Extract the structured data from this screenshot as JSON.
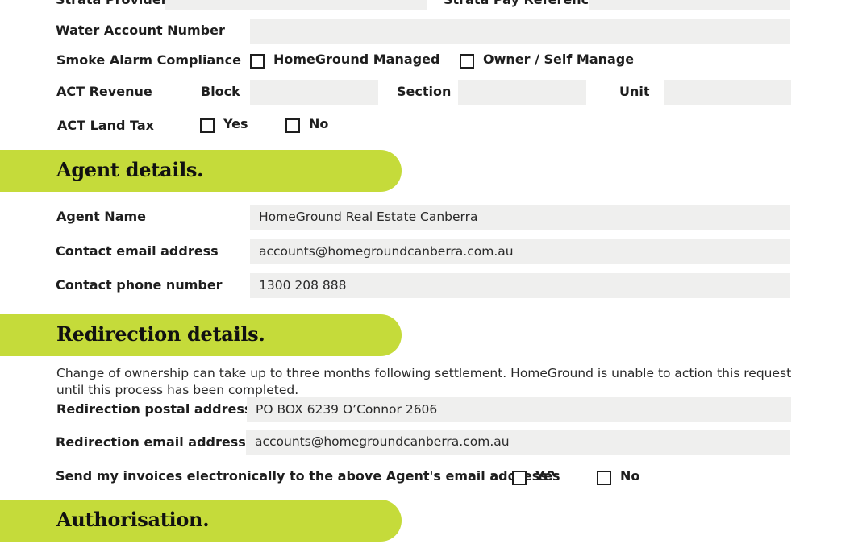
{
  "property_section": {
    "strata_provider_label": "Strata Provider",
    "strata_pay_reference_label": "Strata Pay Reference",
    "water_account_label": "Water Account Number",
    "smoke_alarm_label": "Smoke Alarm Compliance",
    "smoke_alarm_options": [
      "HomeGround Managed",
      "Owner / Self Manage"
    ],
    "act_revenue_label": "ACT Revenue",
    "block_label": "Block",
    "section_label": "Section",
    "unit_label": "Unit",
    "act_land_tax_label": "ACT Land Tax",
    "land_tax_options": [
      "Yes",
      "No"
    ]
  },
  "agent_details": {
    "title": "Agent details.",
    "agent_name_label": "Agent Name",
    "agent_name_value": "HomeGround Real Estate Canberra",
    "email_label": "Contact email address",
    "email_value": "accounts@homegroundcanberra.com.au",
    "phone_label": "Contact phone number",
    "phone_value": "1300 208 888"
  },
  "redirection_details": {
    "title": "Redirection details.",
    "note_line1": "Change of ownership can take up to three months following settlement. HomeGround is unable to action this request",
    "note_line2": "until this process has been completed.",
    "postal_label": "Redirection postal address",
    "postal_value": "PO BOX 6239 O’Connor 2606",
    "email_label": "Redirection email address",
    "email_value": "accounts@homegroundcanberra.com.au",
    "invoice_question": "Send my invoices electronically to the above Agent's email address?",
    "invoice_options": [
      "Yes",
      "No"
    ]
  },
  "authorisation": {
    "title": "Authorisation."
  },
  "colors": {
    "banner": "#c5db3a",
    "field_bg": "#efefee",
    "text": "#1e1e1e"
  }
}
